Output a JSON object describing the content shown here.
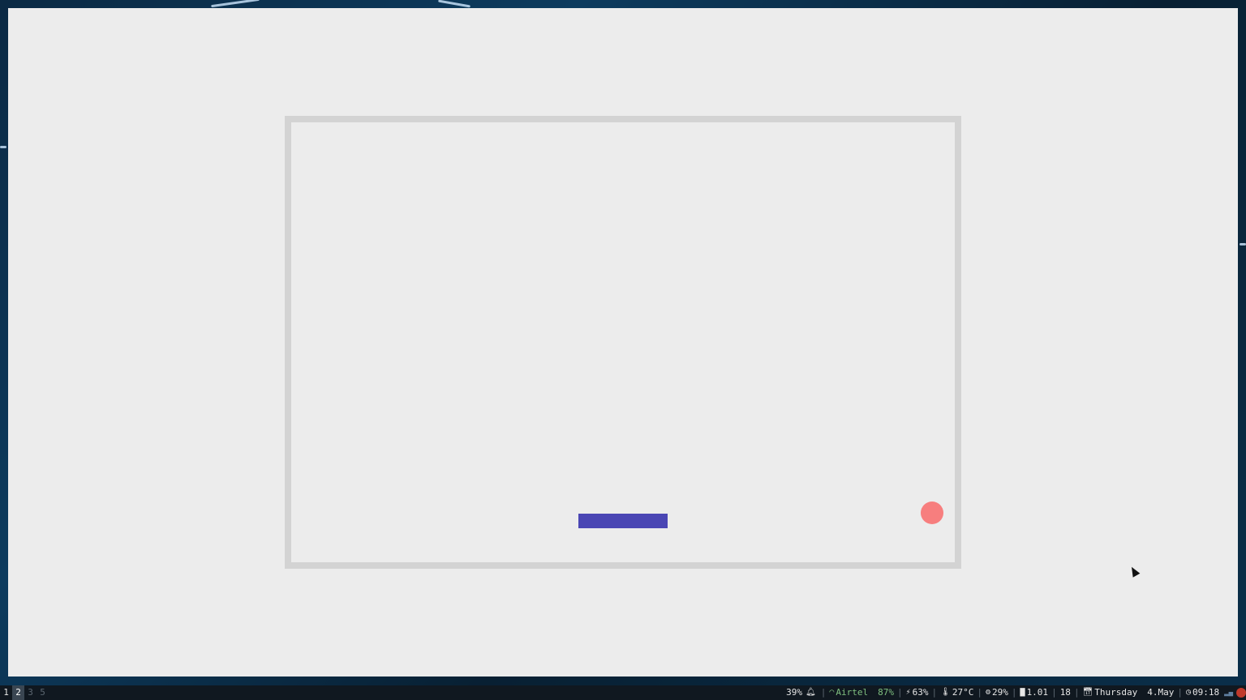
{
  "workspaces": [
    {
      "label": "1",
      "state": "active"
    },
    {
      "label": "2",
      "state": "current"
    },
    {
      "label": "3",
      "state": "inactive"
    },
    {
      "label": "5",
      "state": "inactive"
    }
  ],
  "status": {
    "volume": "39%",
    "notification_icon": "bell-icon",
    "network_icon": "wifi-icon",
    "network_name": "Airtel",
    "wifi_strength": "87%",
    "battery_icon": "battery-charging-icon",
    "battery": "63%",
    "temperature_icon": "thermometer-icon",
    "temperature": "27°C",
    "cpu_icon": "cpu-icon",
    "cpu": "29%",
    "load_icon": "bar-chart-icon",
    "load": "1.01",
    "load_count": "18",
    "calendar_icon": "calendar-icon",
    "day": "Thursday",
    "date": "4.May",
    "clock_icon": "clock-icon",
    "time": "09:18"
  },
  "colors": {
    "paddle": "#4a46b4",
    "ball": "#f77e7e",
    "board_border": "#d3d3d3",
    "background": "#ececec"
  }
}
